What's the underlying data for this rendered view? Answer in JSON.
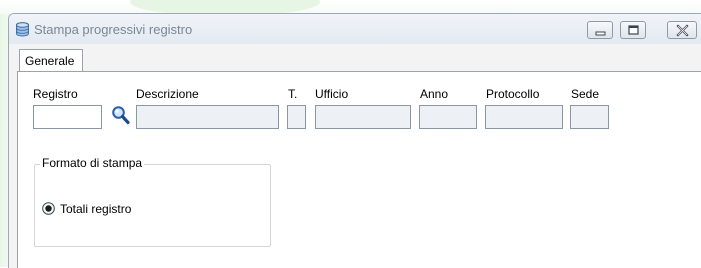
{
  "window": {
    "title": "Stampa progressivi registro",
    "accent": "#7a8696"
  },
  "tabs": [
    {
      "label": "Generale",
      "selected": true
    }
  ],
  "fields": {
    "registro": {
      "label": "Registro",
      "value": ""
    },
    "descrizione": {
      "label": "Descrizione",
      "value": ""
    },
    "tipo": {
      "label": "T.",
      "value": ""
    },
    "ufficio": {
      "label": "Ufficio",
      "value": ""
    },
    "anno": {
      "label": "Anno",
      "value": ""
    },
    "protocollo": {
      "label": "Protocollo",
      "value": ""
    },
    "sede": {
      "label": "Sede",
      "value": ""
    }
  },
  "icons": {
    "app": "database-icon",
    "lookup": "magnifier-icon",
    "minimize": "minimize-icon",
    "maximize": "maximize-icon",
    "close": "close-icon"
  },
  "formato": {
    "legend": "Formato di stampa",
    "options": [
      {
        "label": "Totali registro",
        "checked": true
      }
    ]
  }
}
